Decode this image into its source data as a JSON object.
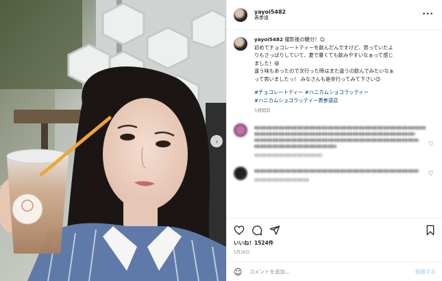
{
  "post": {
    "username": "yayoi5482",
    "location": "表参道",
    "more_icon": "more-horizontal-icon"
  },
  "caption": {
    "username": "yayoi5482",
    "text_lines": [
      " 撮影後の糖分！☺",
      "初めてチョコレートティーを飲んだんですけど、思っていたよ",
      "りもさっぱりしていて、夏で暑くても飲みやすいなぁって感じ",
      "ました！😄",
      "違う味もあったので次行った時はまた違うの飲んでみたいなぁ",
      "って思いましたっ！ みなさんも是非行ってみて下さい😊"
    ],
    "hashtags_line1": "#チョコレートティー #ハニカムショコラッティー",
    "hashtags_line2": "#ハニカムショコラッティー表参道店",
    "time_ago": "5週間前"
  },
  "actions": {
    "like_icon": "heart-icon",
    "comment_icon": "comment-icon",
    "share_icon": "share-icon",
    "save_icon": "bookmark-icon",
    "likes_text": "いいね！1524件",
    "date": "5月26日"
  },
  "comment_box": {
    "placeholder": "コメントを追加...",
    "post_label": "投稿する",
    "emoji_icon": "emoji-icon"
  },
  "photo": {
    "next_icon": "chevron-right-icon"
  }
}
